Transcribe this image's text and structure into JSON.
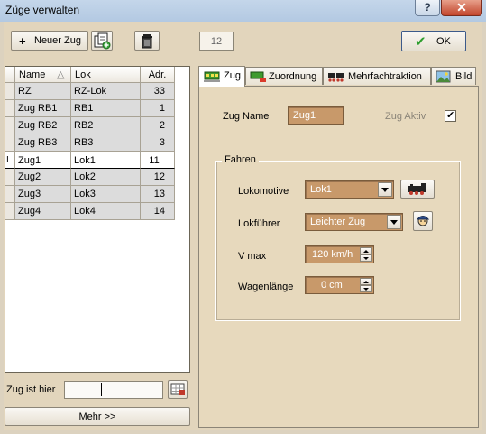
{
  "window": {
    "title": "Züge verwalten",
    "help_glyph": "?",
    "close_glyph": "✕"
  },
  "toolbar": {
    "new_train_plus": "+",
    "new_train_label": "Neuer Zug",
    "count_value": "12",
    "ok_label": "OK",
    "ok_check": "✔"
  },
  "grid": {
    "headers": {
      "name": "Name",
      "sort_glyph": "△",
      "lok": "Lok",
      "adr": "Adr."
    },
    "rows": [
      {
        "name": "RZ",
        "lok": "RZ-Lok",
        "adr": "33"
      },
      {
        "name": "Zug RB1",
        "lok": "RB1",
        "adr": "1"
      },
      {
        "name": "Zug RB2",
        "lok": "RB2",
        "adr": "2"
      },
      {
        "name": "Zug RB3",
        "lok": "RB3",
        "adr": "3"
      },
      {
        "name": "Zug1",
        "lok": "Lok1",
        "adr": "11",
        "selected": true,
        "cursor": "I"
      },
      {
        "name": "Zug2",
        "lok": "Lok2",
        "adr": "12"
      },
      {
        "name": "Zug3",
        "lok": "Lok3",
        "adr": "13"
      },
      {
        "name": "Zug4",
        "lok": "Lok4",
        "adr": "14"
      }
    ]
  },
  "bottom": {
    "location_label": "Zug ist hier",
    "location_value": "",
    "more_label": "Mehr >>"
  },
  "tabs": [
    {
      "label": "Zug",
      "active": true
    },
    {
      "label": "Zuordnung",
      "active": false
    },
    {
      "label": "Mehrfachtraktion",
      "active": false
    },
    {
      "label": "Bild",
      "active": false
    }
  ],
  "zug_tab": {
    "name_label": "Zug Name",
    "name_value": "Zug1",
    "active_label": "Zug Aktiv",
    "active_checked": true,
    "active_check_glyph": "✔",
    "group_title": "Fahren",
    "loco_label": "Lokomotive",
    "loco_value": "Lok1",
    "driver_label": "Lokführer",
    "driver_value": "Leichter Zug",
    "vmax_label": "V max",
    "vmax_value": "120 km/h",
    "length_label": "Wagenlänge",
    "length_value": "0 cm"
  },
  "colors": {
    "field_bg": "#c8996a",
    "page_bg": "#e7d9bd",
    "window_bg": "#e2d5bc",
    "ok_green": "#2e9e2e"
  }
}
